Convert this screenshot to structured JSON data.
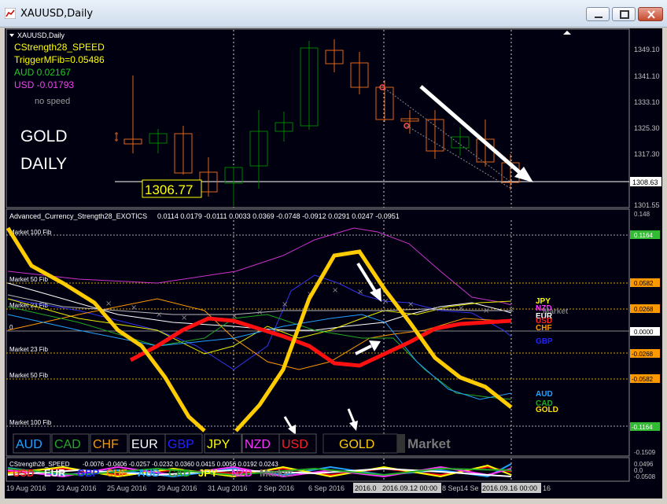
{
  "window": {
    "title": "XAUUSD,Daily"
  },
  "main_chart": {
    "label": "XAUUSD,Daily",
    "indicator_name": "CStrength28_SPEED",
    "trigger": "TriggerMFib=0.05486",
    "aud": "AUD 0.02167",
    "usd": "USD -0.01793",
    "no_speed": "no speed",
    "big_title_1": "GOLD",
    "big_title_2": "DAILY",
    "price_label": "1306.77",
    "current_price": "1308.63",
    "price_ticks": [
      "1349.10",
      "1341.10",
      "1333.10",
      "1325.30",
      "1317.30",
      "1301.55"
    ]
  },
  "sub_chart": {
    "title": "Advanced_Currency_Strength28_EXOTICS",
    "values": "0.0114 0.0179 -0.0111 0.0033 0.0369 -0.0748 -0.0912 0.0291 0.0247 -0.0951",
    "top_value": "0.148",
    "bottom_value": "-0.1509",
    "fib_labels": [
      "Market 100 Fib",
      "Market 50 Fib",
      "Market 23 Fib",
      "0",
      "Market 23 Fib",
      "Market 50 Fib",
      "Market 100 Fib"
    ],
    "fib_values": [
      "0.1164",
      "0.0582",
      "0.0268",
      "0.0000",
      "-0.0268",
      "-0.0582",
      "-0.1164"
    ],
    "right_labels_top": [
      {
        "text": "JPY",
        "color": "#ffff00"
      },
      {
        "text": "NZD",
        "color": "#ff33ff"
      },
      {
        "text": "Market",
        "color": "#777777"
      },
      {
        "text": "EUR",
        "color": "#ffffff"
      },
      {
        "text": "USD",
        "color": "#ff2020"
      },
      {
        "text": "CHF",
        "color": "#ff9900"
      },
      {
        "text": "GBP",
        "color": "#2222ff"
      }
    ],
    "right_labels_bottom": [
      {
        "text": "AUD",
        "color": "#22a2ff"
      },
      {
        "text": "CAD",
        "color": "#22aa22"
      },
      {
        "text": "GOLD",
        "color": "#ffdd00"
      }
    ],
    "legend": [
      {
        "text": "AUD",
        "color": "#22a2ff"
      },
      {
        "text": "CAD",
        "color": "#22aa22"
      },
      {
        "text": "CHF",
        "color": "#ff9900"
      },
      {
        "text": "EUR",
        "color": "#ffffff"
      },
      {
        "text": "GBP",
        "color": "#2222ff"
      },
      {
        "text": "JPY",
        "color": "#ffff00"
      },
      {
        "text": "NZD",
        "color": "#ff33ff"
      },
      {
        "text": "USD",
        "color": "#ff2020"
      }
    ],
    "gold_button": "GOLD",
    "market_label": "Market"
  },
  "speed_chart": {
    "title": "CStrength28_SPEED",
    "values": "-0.0076 -0.0406 -0.0257 -0.0232 0.0360 0.0415 0.0056 0.0192 0.0243",
    "ticks": [
      "0.0496",
      "0.0",
      "-0.0508"
    ],
    "overlay_labels": [
      {
        "text": "USD",
        "color": "#ff2020"
      },
      {
        "text": "EUR",
        "color": "#ffffff"
      },
      {
        "text": "GBP",
        "color": "#2222ff"
      },
      {
        "text": "CHF",
        "color": "#ff9900"
      },
      {
        "text": "AUD",
        "color": "#22a2ff"
      },
      {
        "text": "CAD",
        "color": "#22aa22"
      },
      {
        "text": "JPY",
        "color": "#ffff00"
      },
      {
        "text": "NZD",
        "color": "#ff33ff"
      },
      {
        "text": "Market",
        "color": "#777777"
      }
    ]
  },
  "time_axis": [
    "19 Aug 2016",
    "23 Aug 2016",
    "25 Aug 2016",
    "29 Aug 2016",
    "31 Aug 2016",
    "2 Sep 2016",
    "6 Sep 2016",
    "2016.0",
    "2016.09.12 00:00",
    "8 Sep",
    "14 Se",
    "2016.09.16 00:00",
    "16"
  ],
  "colors": {
    "gold": "#ffcc00",
    "usd": "#ff1010",
    "candle": "#e0661a",
    "bull": "#008000",
    "axis": "#c0c0c0"
  }
}
